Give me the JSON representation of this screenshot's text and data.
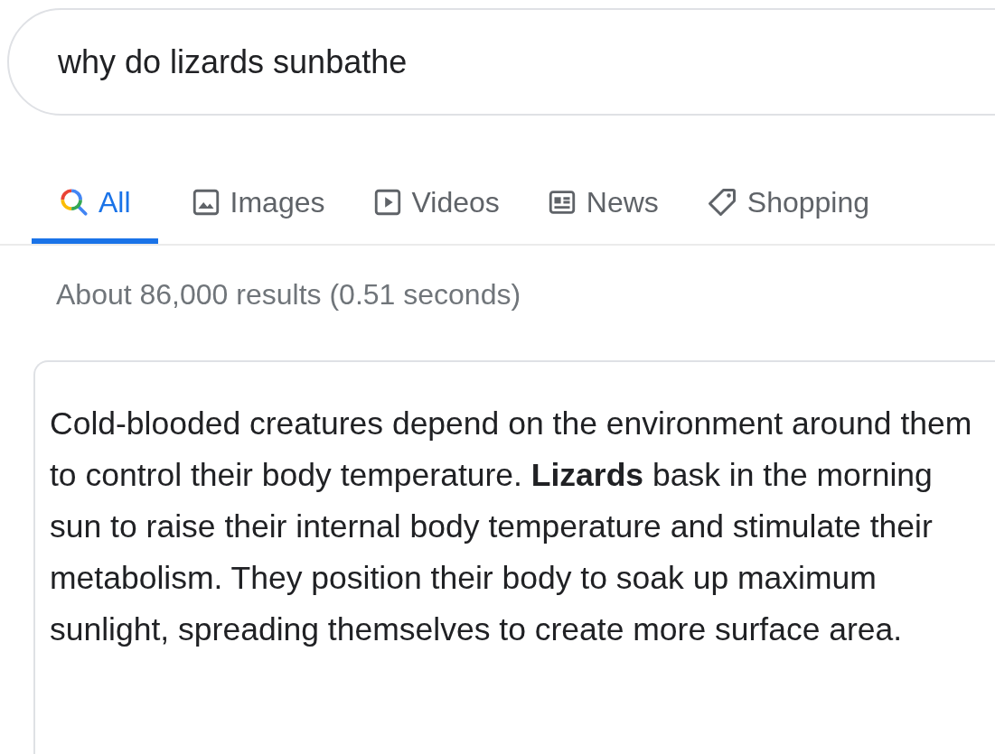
{
  "search": {
    "value": "why do lizards sunbathe"
  },
  "tabs": [
    {
      "label": "All",
      "kind": "search",
      "selected": true
    },
    {
      "label": "Images",
      "kind": "image",
      "selected": false
    },
    {
      "label": "Videos",
      "kind": "video",
      "selected": false
    },
    {
      "label": "News",
      "kind": "news",
      "selected": false
    },
    {
      "label": "Shopping",
      "kind": "tag",
      "selected": false
    }
  ],
  "result_stats": "About 86,000 results (0.51 seconds)",
  "snippet": {
    "text": "Cold-blooded creatures depend on the environment around them to control their body temperature. **Lizards** bask in the morning sun to raise their internal body temperature and stimulate their metabolism. They position their body to soak up maximum sunlight, spreading themselves to create more surface area."
  }
}
